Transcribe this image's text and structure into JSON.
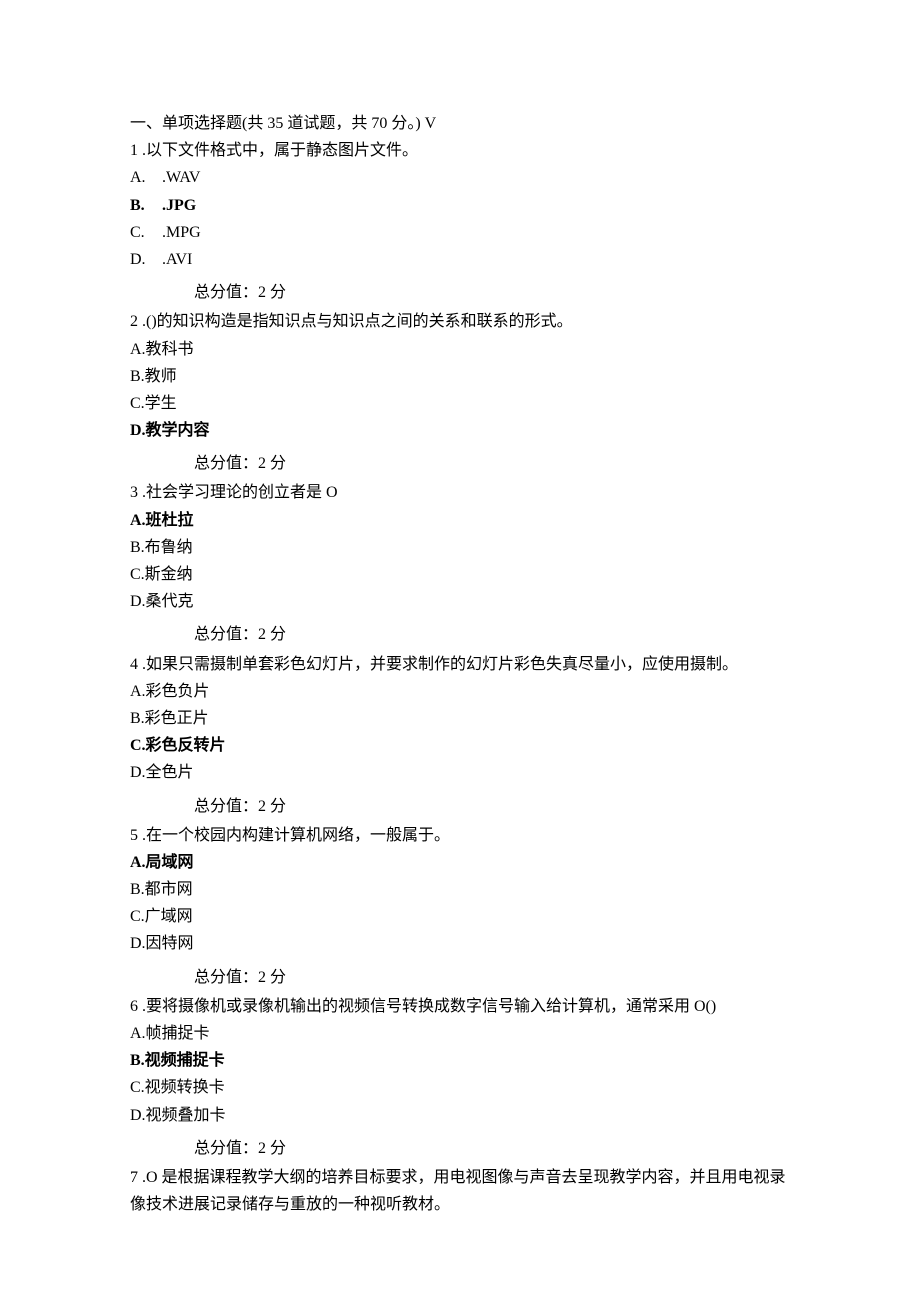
{
  "header": "一、单项选择题(共 35 道试题，共 70 分。) V",
  "score_label": "总分值：2 分",
  "questions": [
    {
      "num": "1",
      "stem": " .以下文件格式中，属于静态图片文件。",
      "opts": [
        {
          "label": "A.",
          "text": ".WAV",
          "bold": false,
          "inline": true
        },
        {
          "label": "B.",
          "text": ".JPG",
          "bold": true,
          "inline": true
        },
        {
          "label": "C.",
          "text": ".MPG",
          "bold": false,
          "inline": true
        },
        {
          "label": "D.",
          "text": ".AVI",
          "bold": false,
          "inline": true
        }
      ],
      "show_score": true
    },
    {
      "num": "2",
      "stem": " .()的知识构造是指知识点与知识点之间的关系和联系的形式。",
      "opts": [
        {
          "label": "A.",
          "text": "教科书",
          "bold": false,
          "inline": false
        },
        {
          "label": "B.",
          "text": "教师",
          "bold": false,
          "inline": false
        },
        {
          "label": "C.",
          "text": "学生",
          "bold": false,
          "inline": false
        },
        {
          "label": "D.",
          "text": "教学内容",
          "bold": true,
          "inline": false
        }
      ],
      "show_score": true
    },
    {
      "num": "3",
      "stem": " .社会学习理论的创立者是 O",
      "opts": [
        {
          "label": "A.",
          "text": "班杜拉",
          "bold": true,
          "inline": false
        },
        {
          "label": "B.",
          "text": "布鲁纳",
          "bold": false,
          "inline": false
        },
        {
          "label": "C.",
          "text": "斯金纳",
          "bold": false,
          "inline": false
        },
        {
          "label": "D.",
          "text": "桑代克",
          "bold": false,
          "inline": false
        }
      ],
      "show_score": true
    },
    {
      "num": "4",
      "stem": " .如果只需摄制单套彩色幻灯片，并要求制作的幻灯片彩色失真尽量小，应使用摄制。",
      "opts": [
        {
          "label": "A.",
          "text": "彩色负片",
          "bold": false,
          "inline": false
        },
        {
          "label": "B.",
          "text": "彩色正片",
          "bold": false,
          "inline": false
        },
        {
          "label": "C.",
          "text": "彩色反转片",
          "bold": true,
          "inline": false
        },
        {
          "label": "D.",
          "text": "全色片",
          "bold": false,
          "inline": false
        }
      ],
      "show_score": true
    },
    {
      "num": "5",
      "stem": " .在一个校园内构建计算机网络，一般属于。",
      "opts": [
        {
          "label": "A.",
          "text": "局域网",
          "bold": true,
          "inline": false
        },
        {
          "label": "B.",
          "text": "都市网",
          "bold": false,
          "inline": false
        },
        {
          "label": "C.",
          "text": "广域网",
          "bold": false,
          "inline": false
        },
        {
          "label": "D.",
          "text": "因特网",
          "bold": false,
          "inline": false
        }
      ],
      "show_score": true
    },
    {
      "num": "6",
      "stem": " .要将摄像机或录像机输出的视频信号转换成数字信号输入给计算机，通常采用 O()",
      "opts": [
        {
          "label": "A.",
          "text": "帧捕捉卡",
          "bold": false,
          "inline": false
        },
        {
          "label": "B.",
          "text": "视频捕捉卡",
          "bold": true,
          "inline": false
        },
        {
          "label": "C.",
          "text": "视频转换卡",
          "bold": false,
          "inline": false
        },
        {
          "label": "D.",
          "text": "视频叠加卡",
          "bold": false,
          "inline": false
        }
      ],
      "show_score": true
    },
    {
      "num": "7",
      "stem": " .O 是根据课程教学大纲的培养目标要求，用电视图像与声音去呈现教学内容，并且用电视录像技术进展记录储存与重放的一种视听教材。",
      "opts": [],
      "show_score": false
    }
  ]
}
